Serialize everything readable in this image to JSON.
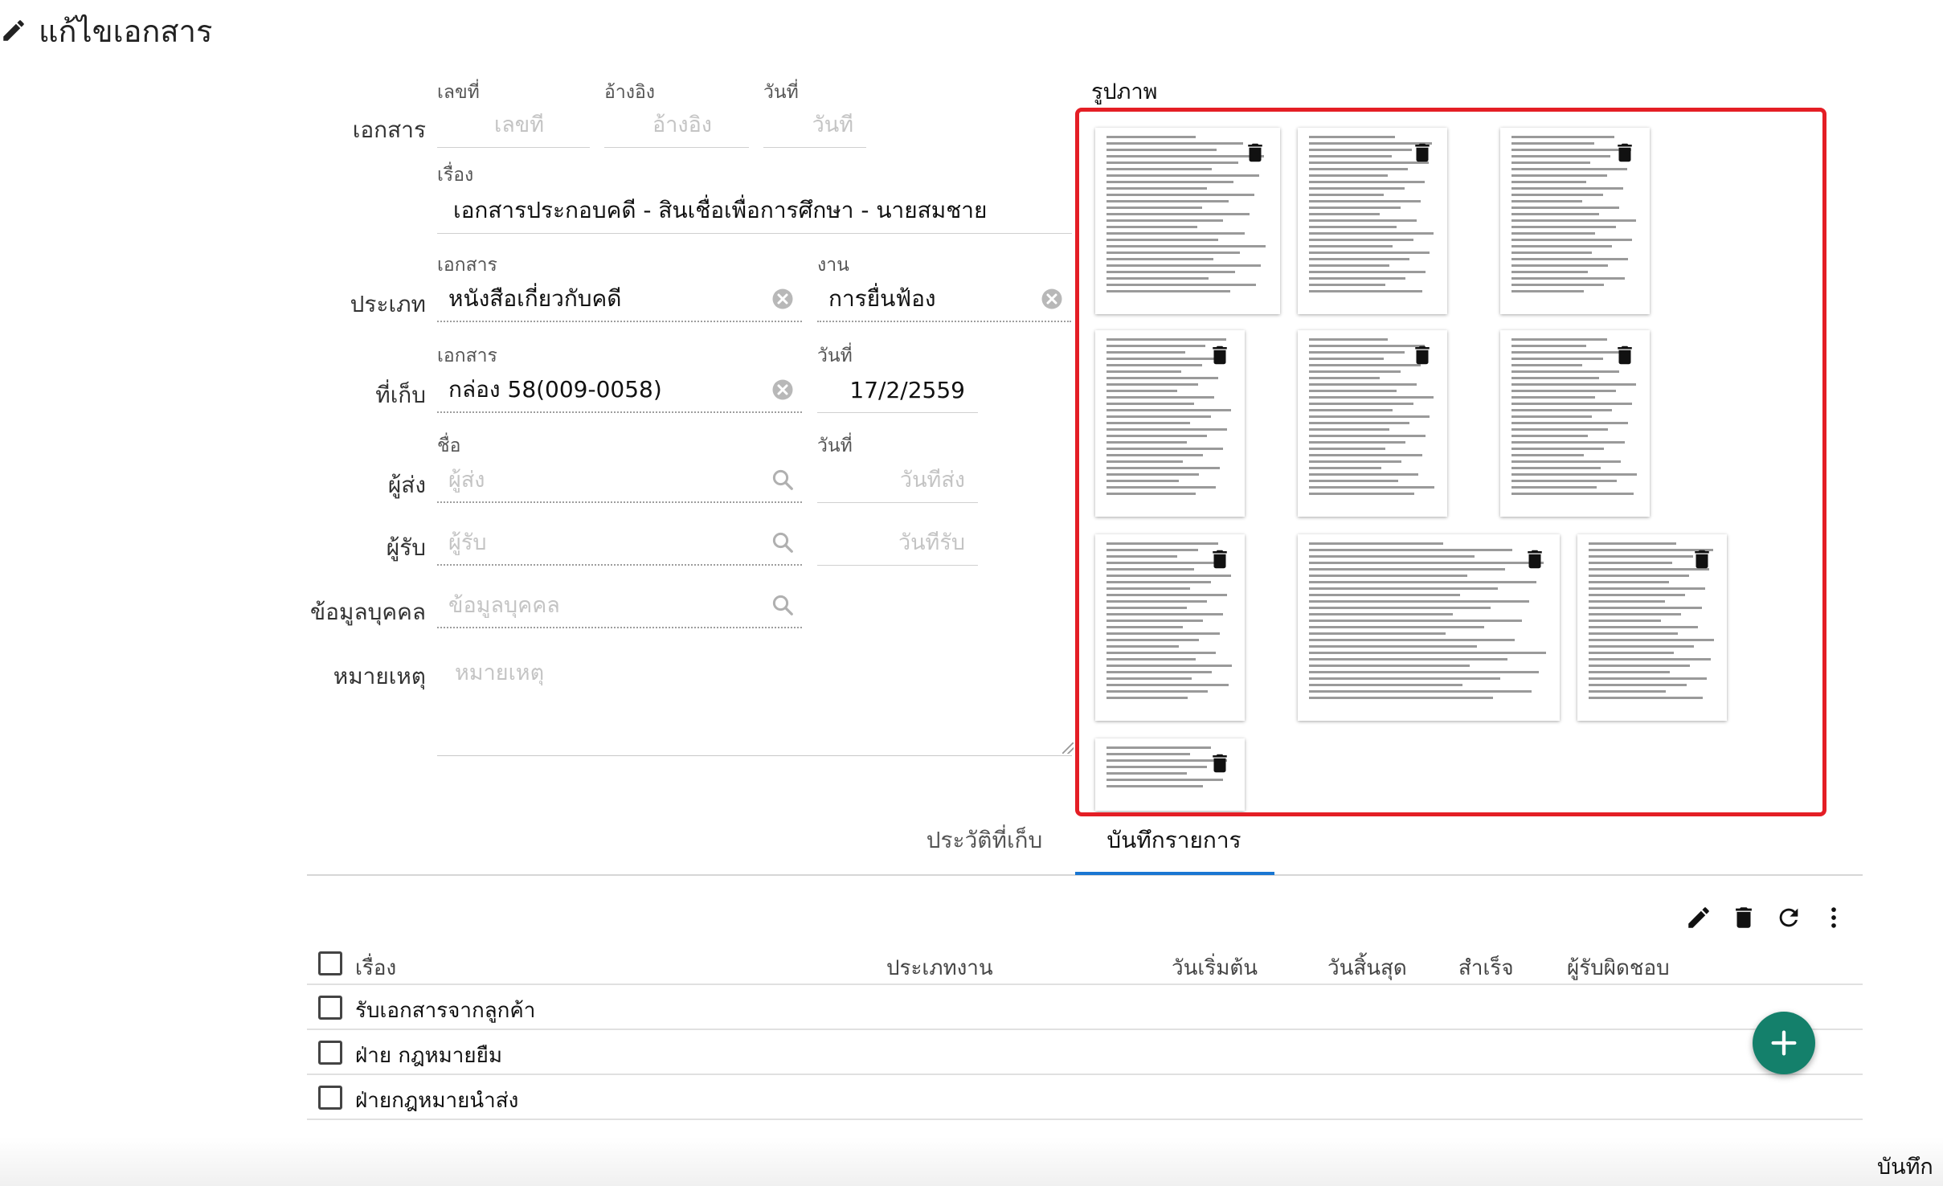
{
  "header": {
    "title": "แก้ไขเอกสาร"
  },
  "form": {
    "document": {
      "row_label": "เอกสาร",
      "number_label": "เลขที่",
      "number_placeholder": "เลขที่",
      "reference_label": "อ้างอิง",
      "reference_placeholder": "อ้างอิง",
      "date_label": "วันที่",
      "date_placeholder": "วันที่"
    },
    "subject": {
      "label": "เรื่อง",
      "value": "เอกสารประกอบคดี - สินเชื่อเพื่อการศึกษา - นายสมชาย"
    },
    "type": {
      "row_label": "ประเภท",
      "doc_label": "เอกสาร",
      "doc_value": "หนังสือเกี่ยวกับคดี",
      "work_label": "งาน",
      "work_value": "การยื่นฟ้อง"
    },
    "storage": {
      "row_label": "ที่เก็บ",
      "doc_label": "เอกสาร",
      "doc_value": "กล่อง 58(009-0058)",
      "date_label": "วันที่",
      "date_value": "17/2/2559"
    },
    "sender": {
      "row_label": "ผู้ส่ง",
      "name_label": "ชื่อ",
      "name_placeholder": "ผู้ส่ง",
      "date_label": "วันที่",
      "date_placeholder": "วันที่ส่ง"
    },
    "receiver": {
      "row_label": "ผู้รับ",
      "name_placeholder": "ผู้รับ",
      "date_placeholder": "วันที่รับ"
    },
    "person": {
      "row_label": "ข้อมูลบุคคล",
      "placeholder": "ข้อมูลบุคคล"
    },
    "remarks": {
      "row_label": "หมายเหตุ",
      "placeholder": "หมายเหตุ"
    }
  },
  "images": {
    "title": "รูปภาพ",
    "count": 10
  },
  "tabs": [
    {
      "label": "ประวัติที่เก็บ",
      "active": false
    },
    {
      "label": "บันทึกรายการ",
      "active": true
    }
  ],
  "toolbar": {
    "icons": [
      "edit-icon",
      "delete-icon",
      "refresh-icon",
      "more-vert-icon"
    ]
  },
  "table": {
    "columns": [
      "เรื่อง",
      "ประเภทงาน",
      "วันเริ่มต้น",
      "วันสิ้นสุด",
      "สำเร็จ",
      "ผู้รับผิดชอบ"
    ],
    "rows": [
      {
        "subject": "รับเอกสารจากลูกค้า"
      },
      {
        "subject": "ฝ่าย กฎหมายยืม"
      },
      {
        "subject": "ฝ่ายกฎหมายนำส่ง"
      }
    ]
  },
  "footer": {
    "save_label": "บันทึก"
  },
  "colors": {
    "accent": "#1976d2",
    "fab": "#14806b",
    "highlight": "#e41e25"
  }
}
